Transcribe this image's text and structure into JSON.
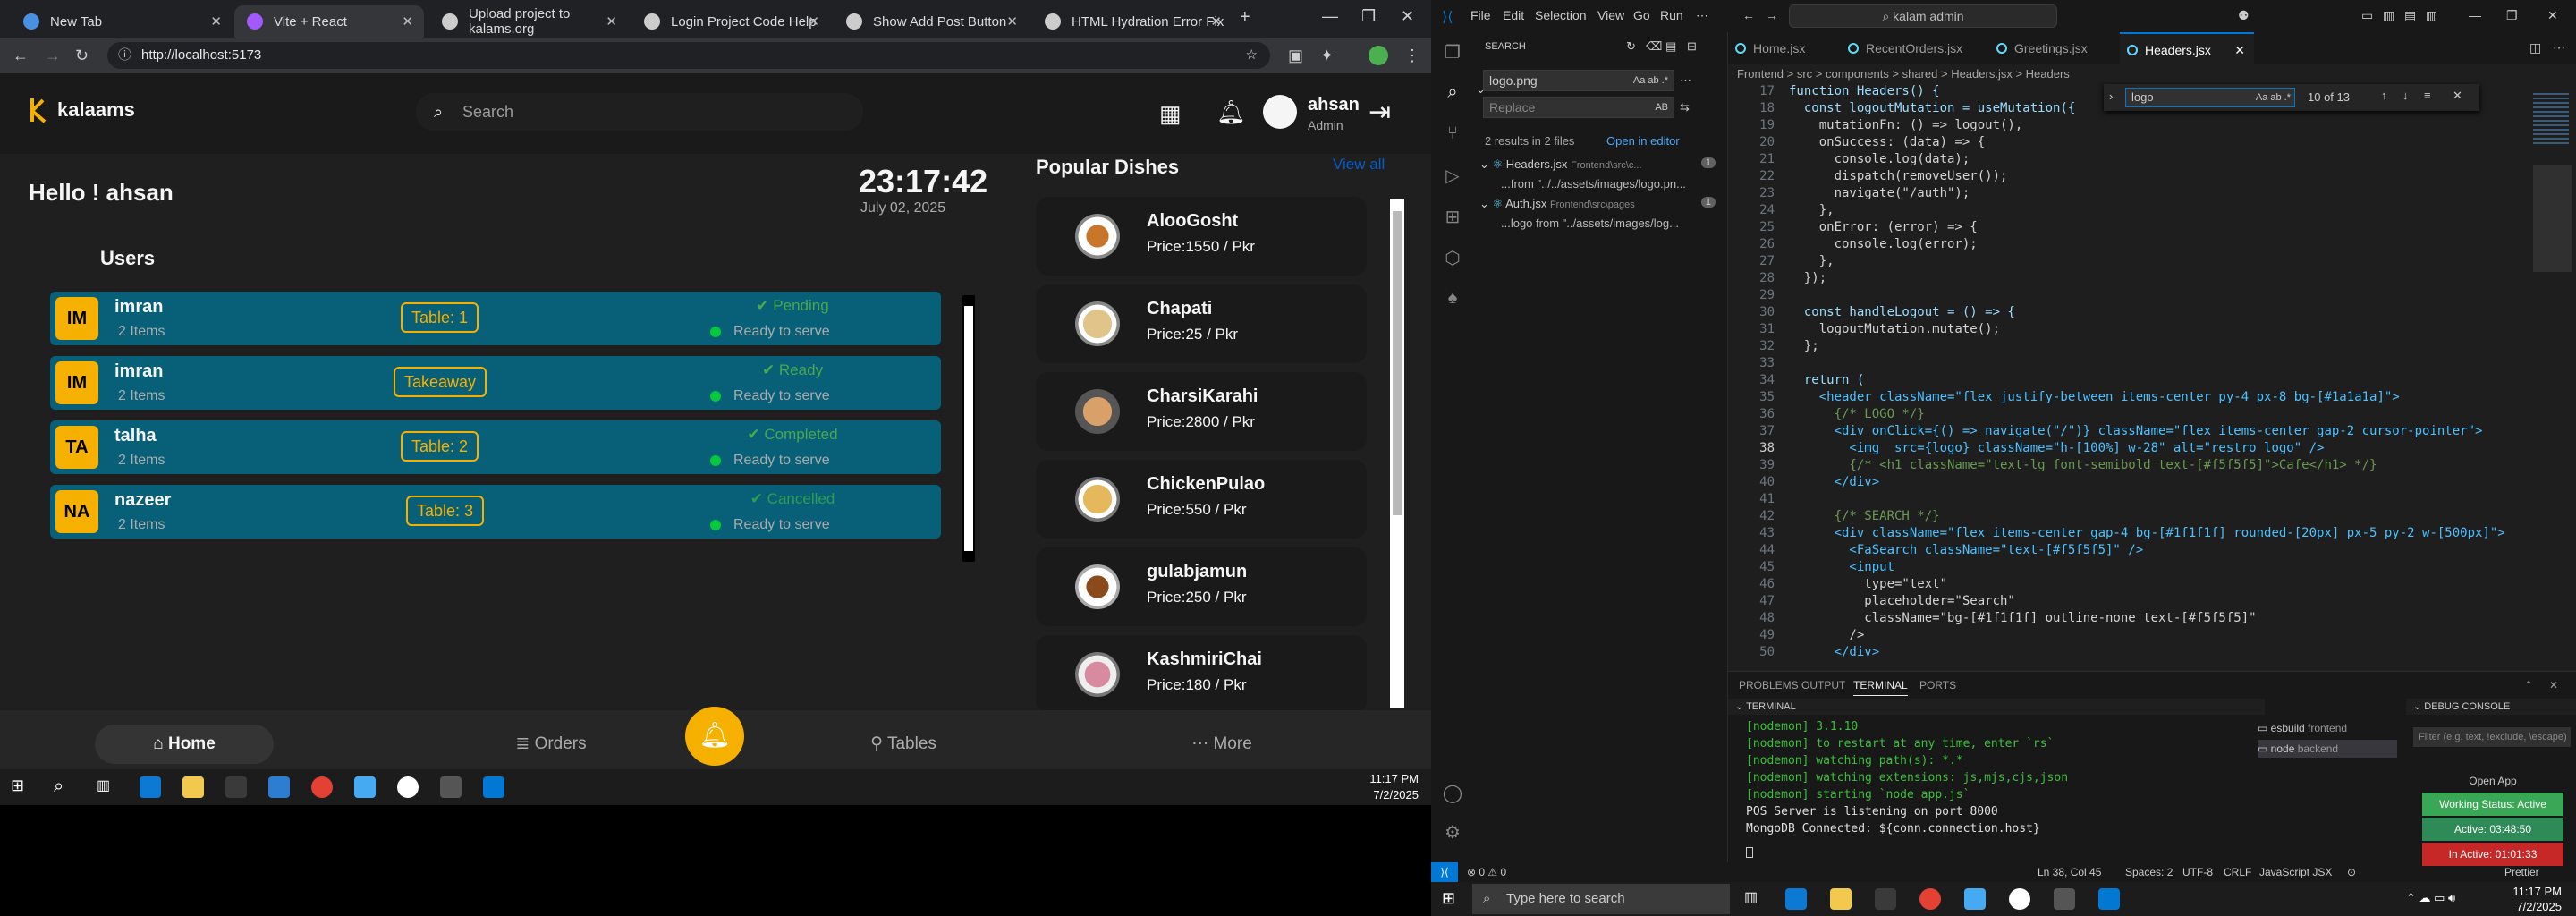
{
  "browser": {
    "tabs": [
      {
        "label": "New Tab",
        "color": "#4a90e2"
      },
      {
        "label": "Vite + React",
        "color": "#a259ff"
      },
      {
        "label": "Upload project to kalams.org",
        "color": "#cccccc"
      },
      {
        "label": "Login Project Code Help",
        "color": "#cccccc"
      },
      {
        "label": "Show Add Post Button",
        "color": "#cccccc"
      },
      {
        "label": "HTML Hydration Error Fix",
        "color": "#cccccc"
      }
    ],
    "url": "http://localhost:5173"
  },
  "app": {
    "logo_text": "kalaams",
    "search_placeholder": "Search",
    "user_name": "ahsan",
    "user_role": "Admin",
    "greeting": "Hello ! ahsan",
    "time": "23:17:42",
    "date": "July 02, 2025",
    "users_title": "Users",
    "users": [
      {
        "initials": "IM",
        "name": "imran",
        "items": "2 Items",
        "table": "Table: 1",
        "status": "Pending",
        "ready": "Ready to serve"
      },
      {
        "initials": "IM",
        "name": "imran",
        "items": "2 Items",
        "table": "Takeaway",
        "status": "Ready",
        "ready": "Ready to serve"
      },
      {
        "initials": "TA",
        "name": "talha",
        "items": "2 Items",
        "table": "Table: 2",
        "status": "Completed",
        "ready": "Ready to serve"
      },
      {
        "initials": "NA",
        "name": "nazeer",
        "items": "2 Items",
        "table": "Table: 3",
        "status": "Cancelled",
        "ready": "Ready to serve"
      }
    ],
    "popular_title": "Popular Dishes",
    "view_all": "View all",
    "dishes": [
      {
        "name": "AlooGosht",
        "price": "Price:1550 / Pkr"
      },
      {
        "name": "Chapati",
        "price": "Price:25 / Pkr"
      },
      {
        "name": "CharsiKarahi",
        "price": "Price:2800 / Pkr"
      },
      {
        "name": "ChickenPulao",
        "price": "Price:550 / Pkr"
      },
      {
        "name": "gulabjamun",
        "price": "Price:250 / Pkr"
      },
      {
        "name": "KashmiriChai",
        "price": "Price:180 / Pkr"
      }
    ],
    "nav": {
      "home": "Home",
      "orders": "Orders",
      "tables": "Tables",
      "more": "More"
    }
  },
  "left_taskbar": {
    "time": "11:17 PM",
    "date": "7/2/2025"
  },
  "vscode": {
    "menu": [
      "File",
      "Edit",
      "Selection",
      "View",
      "Go",
      "Run"
    ],
    "command_center": "kalam admin",
    "search": {
      "title": "SEARCH",
      "query": "logo.png",
      "replace_placeholder": "Replace",
      "summary": "2 results in 2 files",
      "open_in_editor": "Open in editor",
      "results": [
        {
          "file": "Headers.jsx",
          "path": "Frontend\\src\\c...",
          "count": "1",
          "match": "...from \"../../assets/images/logo.pn..."
        },
        {
          "file": "Auth.jsx",
          "path": "Frontend\\src\\pages",
          "count": "1",
          "match": "...logo from \"../assets/images/log..."
        }
      ]
    },
    "tabs": [
      "Home.jsx",
      "RecentOrders.jsx",
      "Greetings.jsx",
      "Headers.jsx"
    ],
    "breadcrumbs": "Frontend  >  src  >  components  >  shared  >  Headers.jsx  >  Headers",
    "find": {
      "query": "logo",
      "count": "10 of 13"
    },
    "code": [
      {
        "n": "17",
        "t": "function Headers() {"
      },
      {
        "n": "18",
        "t": "  const logoutMutation = useMutation({"
      },
      {
        "n": "19",
        "t": "    mutationFn: () => logout(),"
      },
      {
        "n": "20",
        "t": "    onSuccess: (data) => {"
      },
      {
        "n": "21",
        "t": "      console.log(data);"
      },
      {
        "n": "22",
        "t": "      dispatch(removeUser());"
      },
      {
        "n": "23",
        "t": "      navigate(\"/auth\");"
      },
      {
        "n": "24",
        "t": "    },"
      },
      {
        "n": "25",
        "t": "    onError: (error) => {"
      },
      {
        "n": "26",
        "t": "      console.log(error);"
      },
      {
        "n": "27",
        "t": "    },"
      },
      {
        "n": "28",
        "t": "  });"
      },
      {
        "n": "29",
        "t": ""
      },
      {
        "n": "30",
        "t": "  const handleLogout = () => {"
      },
      {
        "n": "31",
        "t": "    logoutMutation.mutate();"
      },
      {
        "n": "32",
        "t": "  };"
      },
      {
        "n": "33",
        "t": ""
      },
      {
        "n": "34",
        "t": "  return ("
      },
      {
        "n": "35",
        "t": "    <header className=\"flex justify-between items-center py-4 px-8 bg-[#1a1a1a]\">"
      },
      {
        "n": "36",
        "t": "      {/* LOGO */}"
      },
      {
        "n": "37",
        "t": "      <div onClick={() => navigate(\"/\")} className=\"flex items-center gap-2 cursor-pointer\">"
      },
      {
        "n": "38",
        "t": "        <img  src={logo} className=\"h-[100%] w-28\" alt=\"restro logo\" />"
      },
      {
        "n": "39",
        "t": "        {/* <h1 className=\"text-lg font-semibold text-[#f5f5f5]\">Cafe</h1> */}"
      },
      {
        "n": "40",
        "t": "      </div>"
      },
      {
        "n": "41",
        "t": ""
      },
      {
        "n": "42",
        "t": "      {/* SEARCH */}"
      },
      {
        "n": "43",
        "t": "      <div className=\"flex items-center gap-4 bg-[#1f1f1f] rounded-[20px] px-5 py-2 w-[500px]\">"
      },
      {
        "n": "44",
        "t": "        <FaSearch className=\"text-[#f5f5f5]\" />"
      },
      {
        "n": "45",
        "t": "        <input"
      },
      {
        "n": "46",
        "t": "          type=\"text\""
      },
      {
        "n": "47",
        "t": "          placeholder=\"Search\""
      },
      {
        "n": "48",
        "t": "          className=\"bg-[#1f1f1f] outline-none text-[#f5f5f5]\""
      },
      {
        "n": "49",
        "t": "        />"
      },
      {
        "n": "50",
        "t": "      </div>"
      }
    ],
    "current_line": "38",
    "panel_tabs": [
      "PROBLEMS",
      "OUTPUT",
      "TERMINAL",
      "PORTS"
    ],
    "terminal_title": "TERMINAL",
    "debug_title": "DEBUG CONSOLE",
    "terminal_lines": [
      "[nodemon] 3.1.10",
      "[nodemon] to restart at any time, enter `rs`",
      "[nodemon] watching path(s): *.*",
      "[nodemon] watching extensions: js,mjs,cjs,json",
      "[nodemon] starting `node app.js`",
      "POS Server is listening on port 8000",
      "MongoDB Connected: ${conn.connection.host}"
    ],
    "terminals": [
      {
        "name": "esbuild",
        "sub": "frontend"
      },
      {
        "name": "node",
        "sub": "backend"
      }
    ],
    "filter_placeholder": "Filter (e.g. text, !exclude, \\escape)",
    "status": {
      "left": "⊗ 0  ⚠ 0",
      "pos": "Ln 38, Col 45",
      "spaces": "Spaces: 2",
      "enc": "UTF-8",
      "eol": "CRLF",
      "lang": "JavaScript JSX",
      "prettier": "Prettier"
    },
    "toasts": [
      "Open App",
      "Working Status: Active",
      "Active: 03:48:50",
      "In Active: 01:01:33"
    ]
  },
  "right_taskbar": {
    "search": "Type here to search",
    "time": "11:17 PM",
    "date": "7/2/2025"
  }
}
